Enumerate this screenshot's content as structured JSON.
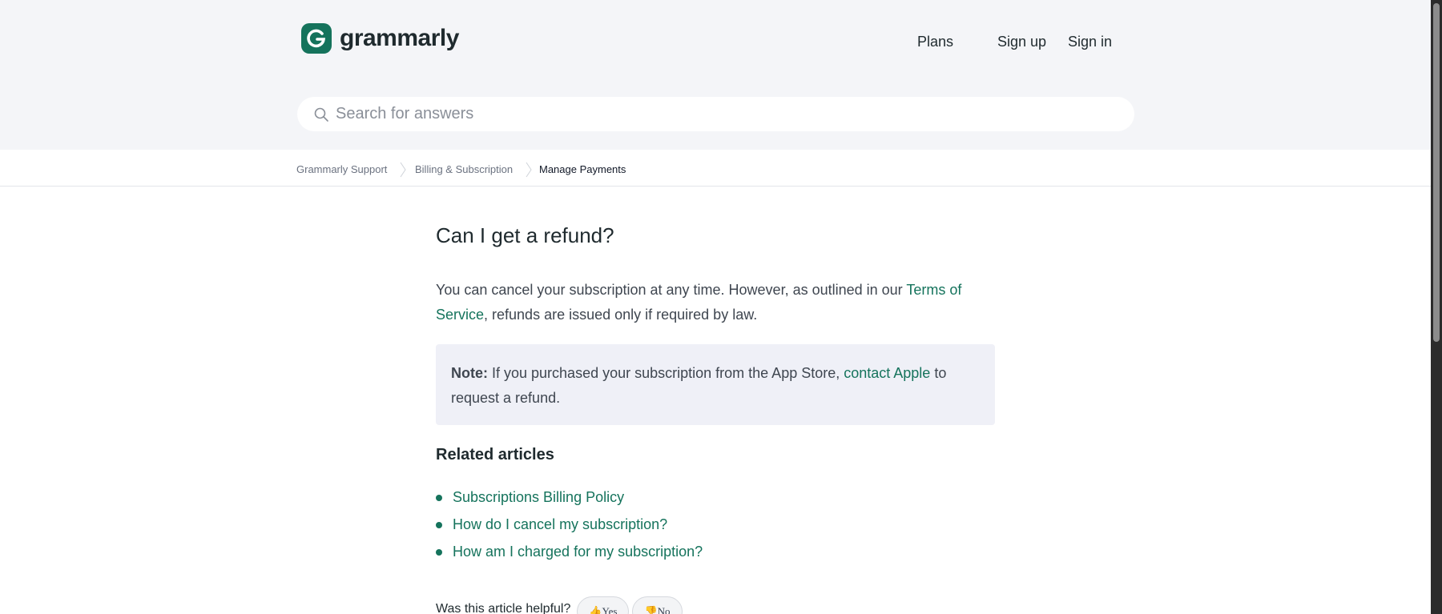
{
  "brand": {
    "name": "grammarly",
    "accent": "#15735c"
  },
  "nav": {
    "plans": "Plans",
    "signup": "Sign up",
    "signin": "Sign in"
  },
  "search": {
    "placeholder": "Search for answers",
    "icon": "search-icon"
  },
  "breadcrumb": [
    {
      "label": "Grammarly Support"
    },
    {
      "label": "Billing & Subscription"
    },
    {
      "label": "Manage Payments"
    }
  ],
  "article": {
    "title": "Can I get a refund?",
    "intro_text": "You can cancel your subscription at any time. However, as outlined in our ",
    "intro_link": "Terms of Service",
    "intro_tail": ", refunds are issued only if required by law.",
    "note_label": "Note:",
    "note_text": " If you purchased your subscription from the App Store, ",
    "note_link": "contact Apple",
    "note_tail": " to request a refund."
  },
  "related": {
    "title": "Related articles",
    "items": [
      "Subscriptions Billing Policy",
      "How do I cancel my subscription?",
      "How am I charged for my subscription?"
    ]
  },
  "feedback": {
    "question": "Was this article helpful?",
    "yes": "👍Yes",
    "no": "👎No"
  }
}
